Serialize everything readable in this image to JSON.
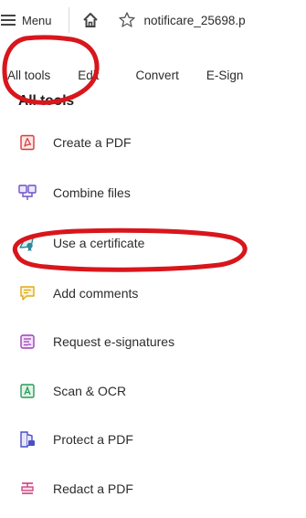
{
  "topbar": {
    "menu_label": "Menu",
    "doc_title": "notificare_25698.p"
  },
  "tabs": [
    {
      "label": "All tools"
    },
    {
      "label": "Edit"
    },
    {
      "label": "Convert"
    },
    {
      "label": "E-Sign"
    }
  ],
  "section": {
    "heading": "All tools"
  },
  "tools": [
    {
      "label": "Create a PDF",
      "icon": "create-pdf-icon",
      "color": "#d9383a"
    },
    {
      "label": "Combine files",
      "icon": "combine-files-icon",
      "color": "#6b53c8"
    },
    {
      "label": "Use a certificate",
      "icon": "certificate-icon",
      "color": "#2e8a99"
    },
    {
      "label": "Add comments",
      "icon": "comment-icon",
      "color": "#e6b429"
    },
    {
      "label": "Request e-signatures",
      "icon": "request-signature-icon",
      "color": "#9b3fb8"
    },
    {
      "label": "Scan & OCR",
      "icon": "scan-ocr-icon",
      "color": "#2a9a5b"
    },
    {
      "label": "Protect a PDF",
      "icon": "protect-pdf-icon",
      "color": "#4b4fc4"
    },
    {
      "label": "Redact a PDF",
      "icon": "redact-pdf-icon",
      "color": "#cc3d7d"
    }
  ],
  "annotation_color": "#d8161c"
}
